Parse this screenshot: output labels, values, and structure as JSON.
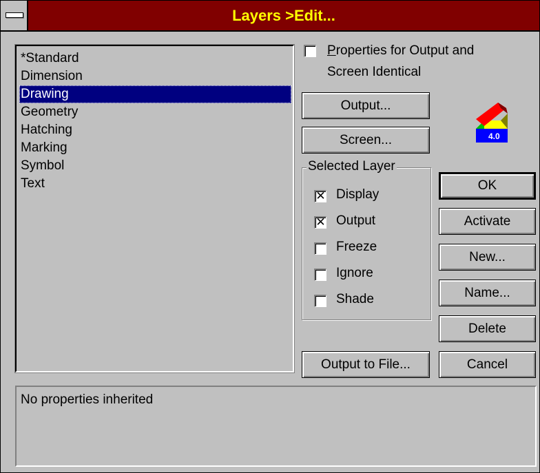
{
  "window": {
    "title": "Layers >Edit..."
  },
  "layers": {
    "items": [
      "*Standard",
      "Dimension",
      "Drawing",
      "Geometry",
      "Hatching",
      "Marking",
      "Symbol",
      "Text"
    ],
    "selected_index": 2
  },
  "properties_identical": {
    "label": "Properties for Output and",
    "label_line2": "Screen Identical",
    "checked": false
  },
  "buttons": {
    "output": "Output...",
    "screen": "Screen...",
    "output_to_file": "Output to File...",
    "ok": "OK",
    "activate": "Activate",
    "new": "New...",
    "name": "Name...",
    "delete": "Delete",
    "cancel": "Cancel"
  },
  "selected_layer": {
    "title": "Selected Layer",
    "display": {
      "label": "Display",
      "checked": true
    },
    "output": {
      "label": "Output",
      "checked": true
    },
    "freeze": {
      "label": "Freeze",
      "checked": false
    },
    "ignore": {
      "label": "Ignore",
      "checked": false
    },
    "shade": {
      "label": "Shade",
      "checked": false
    }
  },
  "logo": {
    "version": "4.0",
    "colors": [
      "#ff0000",
      "#00c000",
      "#ffff00",
      "#0000ff"
    ]
  },
  "status": {
    "text": "No properties inherited"
  }
}
